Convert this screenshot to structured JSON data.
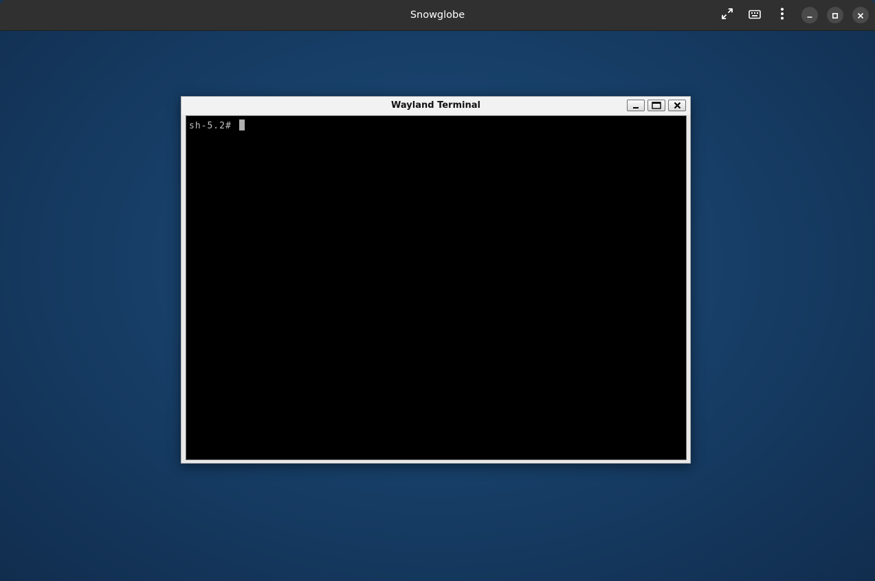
{
  "outer_window": {
    "title": "Snowglobe",
    "buttons": {
      "fullscreen_icon": "fullscreen-icon",
      "keyboard_icon": "keyboard-icon",
      "menu_icon": "kebab-menu-icon",
      "minimize_icon": "minimize-icon",
      "maximize_icon": "maximize-icon",
      "close_icon": "close-icon"
    }
  },
  "terminal_window": {
    "title": "Wayland Terminal",
    "prompt": "sh-5.2#"
  },
  "colors": {
    "header_bg": "#303030",
    "desktop_bg": "#173f68",
    "terminal_bg": "#000000",
    "terminal_fg": "#bfbfbf"
  }
}
